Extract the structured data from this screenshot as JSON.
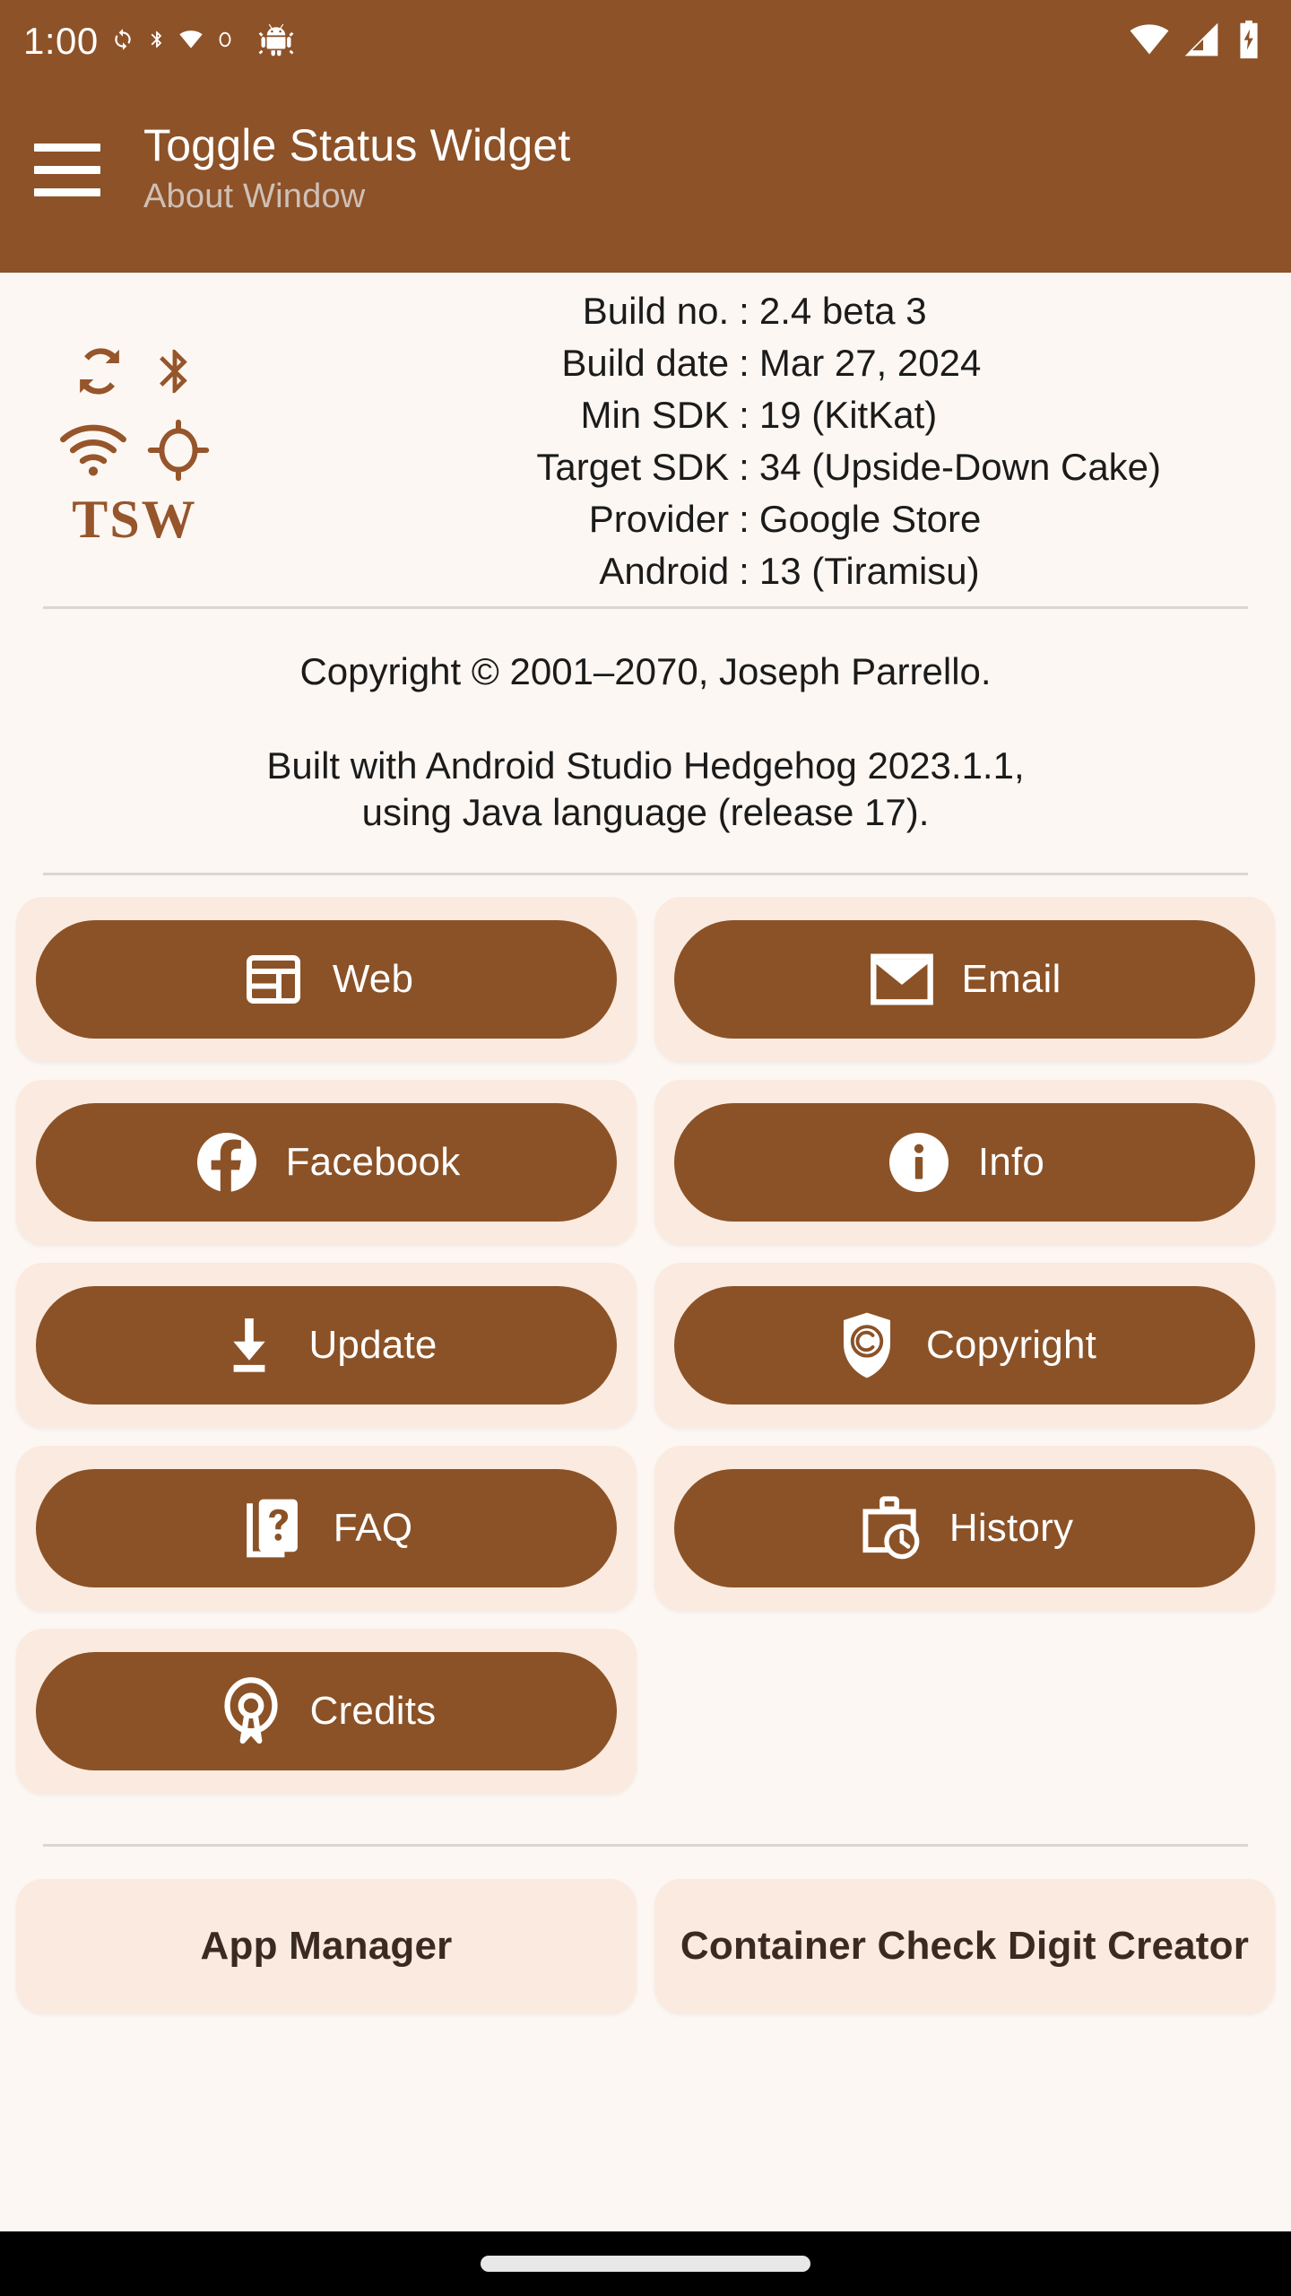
{
  "status_bar": {
    "clock": "1:00",
    "left_icons": [
      "sync-icon",
      "bluetooth-icon",
      "wifi-icon",
      "gps-icon",
      "android-debug-icon"
    ],
    "right_icons": [
      "wifi-signal-icon",
      "cellular-signal-icon",
      "battery-charging-icon"
    ]
  },
  "app_bar": {
    "menu_icon": "hamburger-menu-icon",
    "title": "Toggle Status Widget",
    "subtitle": "About Window"
  },
  "logo": {
    "wordmark": "TSW",
    "icons": [
      "sync-icon",
      "bluetooth-icon",
      "wifi-icon",
      "gps-icon"
    ]
  },
  "build_info": [
    {
      "label": "Build no.",
      "sep": ":",
      "value": "2.4 beta 3"
    },
    {
      "label": "Build date",
      "sep": ":",
      "value": "Mar 27, 2024"
    },
    {
      "label": "Min SDK",
      "sep": ":",
      "value": "19 (KitKat)"
    },
    {
      "label": "Target SDK",
      "sep": ":",
      "value": "34 (Upside-Down Cake)"
    },
    {
      "label": "Provider",
      "sep": ":",
      "value": "Google Store"
    },
    {
      "label": "Android",
      "sep": ":",
      "value": "13 (Tiramisu)"
    }
  ],
  "legal": {
    "copyright": "Copyright © 2001–2070, Joseph Parrello.",
    "built_line1": "Built with Android Studio Hedgehog 2023.1.1,",
    "built_line2": "using Java language (release 17)."
  },
  "actions": [
    {
      "label": "Web",
      "icon": "browser-window-icon"
    },
    {
      "label": "Email",
      "icon": "envelope-icon"
    },
    {
      "label": "Facebook",
      "icon": "facebook-icon"
    },
    {
      "label": "Info",
      "icon": "info-circle-icon"
    },
    {
      "label": "Update",
      "icon": "download-icon"
    },
    {
      "label": "Copyright",
      "icon": "shield-copyright-icon"
    },
    {
      "label": "FAQ",
      "icon": "faq-pages-icon"
    },
    {
      "label": "History",
      "icon": "briefcase-clock-icon"
    },
    {
      "label": "Credits",
      "icon": "open-source-icon"
    }
  ],
  "footer_apps": [
    {
      "label": "App Manager"
    },
    {
      "label": "Container Check Digit Creator"
    }
  ],
  "colors": {
    "brand_brown": "#8D5228",
    "button_brown": "#8B5227",
    "card_peach": "#FBEADF",
    "page_bg": "#FDF7F3",
    "logo_brown": "#96552B",
    "divider": "#DCD6D2",
    "subtitle_grey": "#CFC0B6"
  },
  "nav_bar": {
    "handle": "home-gesture-handle"
  }
}
